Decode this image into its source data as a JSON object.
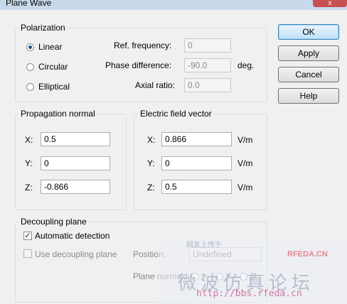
{
  "window": {
    "title": "Plane Wave",
    "close_label": "x"
  },
  "polarization": {
    "label": "Polarization",
    "options": [
      "Linear",
      "Circular",
      "Elliptical"
    ],
    "selected": "Linear",
    "ref_frequency": {
      "label": "Ref. frequency:",
      "value": "0"
    },
    "phase_difference": {
      "label": "Phase difference:",
      "value": "-90.0",
      "unit": "deg."
    },
    "axial_ratio": {
      "label": "Axial ratio:",
      "value": "0.0"
    }
  },
  "buttons": {
    "ok": "OK",
    "apply": "Apply",
    "cancel": "Cancel",
    "help": "Help"
  },
  "propagation": {
    "label": "Propagation normal",
    "x": {
      "label": "X:",
      "value": "0.5"
    },
    "y": {
      "label": "Y:",
      "value": "0"
    },
    "z": {
      "label": "Z:",
      "value": "-0.866"
    }
  },
  "efield": {
    "label": "Electric field vector",
    "x": {
      "label": "X:",
      "value": "0.866",
      "unit": "V/m"
    },
    "y": {
      "label": "Y:",
      "value": "0",
      "unit": "V/m"
    },
    "z": {
      "label": "Z:",
      "value": "0.5",
      "unit": "V/m"
    }
  },
  "decoupling": {
    "label": "Decoupling plane",
    "auto_detection": {
      "label": "Automatic detection",
      "checked": true
    },
    "use_plane": {
      "label": "Use decoupling plane",
      "checked": false
    },
    "position": {
      "label": "Position:",
      "value": "Undefined"
    },
    "plane_normal": {
      "label": "Plane normal:",
      "options": [
        "x",
        "Y",
        "Z"
      ]
    }
  },
  "watermark": {
    "text_small": "网友上传于",
    "brand": "RFEDA.CN",
    "chinese": "微波仿真论坛",
    "url": "http://bbs.rfeda.cn"
  }
}
